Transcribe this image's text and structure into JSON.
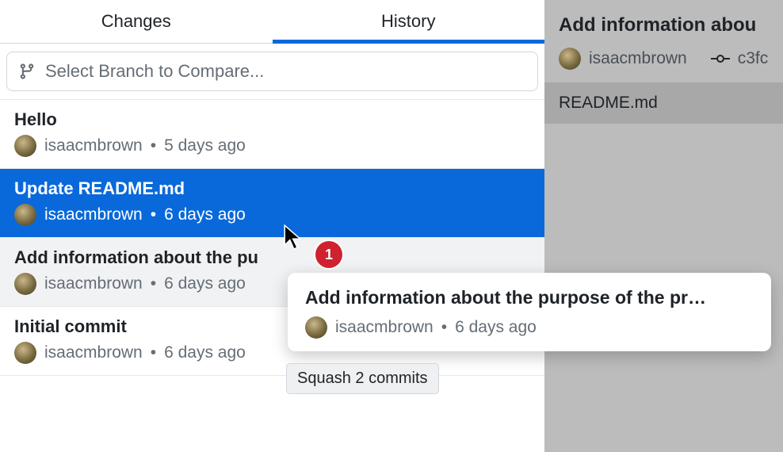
{
  "tabs": {
    "changes": "Changes",
    "history": "History"
  },
  "branchSelect": {
    "placeholder": "Select Branch to Compare..."
  },
  "commits": [
    {
      "title": "Hello",
      "author": "isaacmbrown",
      "time": "5 days ago"
    },
    {
      "title": "Update README.md",
      "author": "isaacmbrown",
      "time": "6 days ago"
    },
    {
      "title": "Add information about the pu",
      "author": "isaacmbrown",
      "time": "6 days ago"
    },
    {
      "title": "Initial commit",
      "author": "isaacmbrown",
      "time": "6 days ago"
    }
  ],
  "detail": {
    "title": "Add information abou",
    "author": "isaacmbrown",
    "sha": "c3fc",
    "file": "README.md"
  },
  "drag": {
    "badge": "1",
    "title": "Add information about the purpose of the pr…",
    "author": "isaacmbrown",
    "time": "6 days ago",
    "tooltip": "Squash 2 commits"
  },
  "sep": "•"
}
